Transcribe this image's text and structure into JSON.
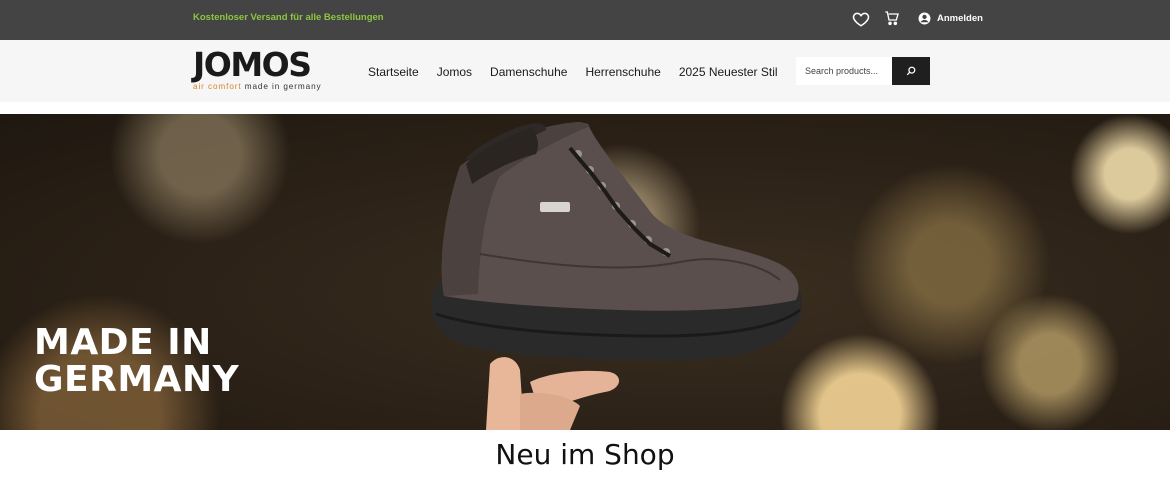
{
  "topbar": {
    "promo": "Kostenloser Versand für alle Bestellungen",
    "wishlist_icon": "heart-icon",
    "cart_icon": "cart-icon",
    "account_icon": "user-circle-icon",
    "account_label": "Anmelden",
    "background": "#444444",
    "promo_color": "#8cc63f"
  },
  "header": {
    "logo": {
      "word": "JOMOS",
      "tag_highlight": "air comfort",
      "tag_rest": " made in germany"
    },
    "nav": [
      {
        "label": "Startseite"
      },
      {
        "label": "Jomos"
      },
      {
        "label": "Damenschuhe"
      },
      {
        "label": "Herrenschuhe"
      },
      {
        "label": "2025 Neuester Stil"
      }
    ],
    "search": {
      "placeholder": "Search products...",
      "button_icon": "search-icon"
    }
  },
  "hero": {
    "headline_line1": "MADE IN",
    "headline_line2": "GERMANY"
  },
  "section": {
    "title": "Neu im Shop"
  }
}
